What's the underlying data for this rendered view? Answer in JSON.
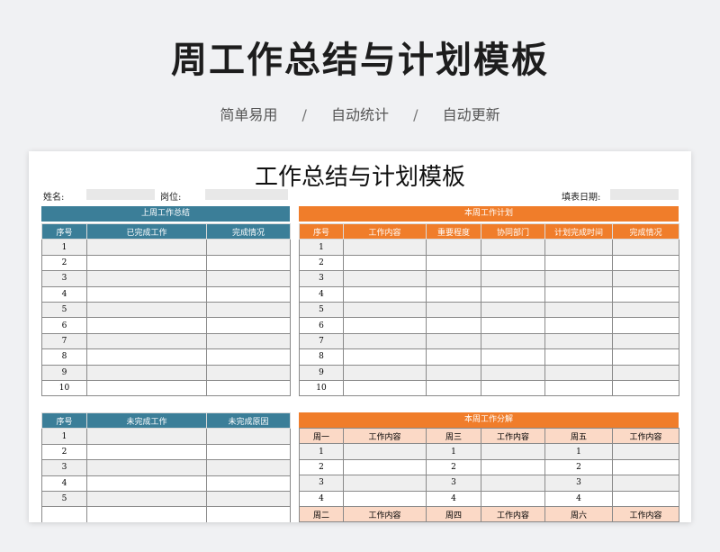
{
  "hero": {
    "title": "周工作总结与计划模板",
    "tags": [
      "简单易用",
      "自动统计",
      "自动更新"
    ],
    "separator": "/"
  },
  "sheet": {
    "title": "工作总结与计划模板",
    "name_label": "姓名:",
    "position_label": "岗位:",
    "date_label": "填表日期:"
  },
  "last_week": {
    "title": "上周工作总结",
    "headers": [
      "序号",
      "已完成工作",
      "完成情况"
    ],
    "rows": [
      "1",
      "2",
      "3",
      "4",
      "5",
      "6",
      "7",
      "8",
      "9",
      "10"
    ]
  },
  "this_week": {
    "title": "本周工作计划",
    "headers": [
      "序号",
      "工作内容",
      "重要程度",
      "协同部门",
      "计划完成时间",
      "完成情况"
    ],
    "rows": [
      "1",
      "2",
      "3",
      "4",
      "5",
      "6",
      "7",
      "8",
      "9",
      "10"
    ]
  },
  "unfinished": {
    "headers": [
      "序号",
      "未完成工作",
      "未完成原因"
    ],
    "rows": [
      "1",
      "2",
      "3",
      "4",
      "5"
    ]
  },
  "breakdown": {
    "title": "本周工作分解",
    "headers": [
      "周一",
      "工作内容",
      "周三",
      "工作内容",
      "周五",
      "工作内容"
    ],
    "rows": [
      "1",
      "2",
      "3",
      "4"
    ],
    "next_headers": [
      "周二",
      "工作内容",
      "周四",
      "工作内容",
      "周六",
      "工作内容"
    ]
  },
  "colors": {
    "teal": "#3b7e98",
    "orange": "#f07d2a",
    "peach": "#fbd9c6"
  }
}
